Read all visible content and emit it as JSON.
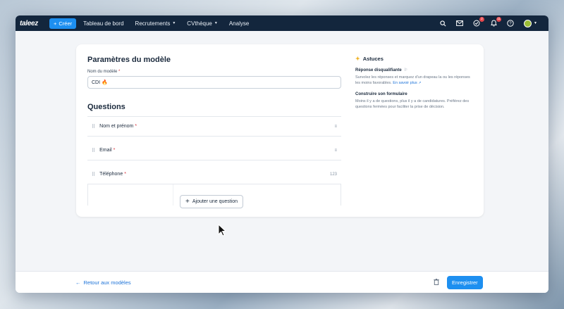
{
  "topbar": {
    "logo": "taleez",
    "create_label": "Créer",
    "nav": [
      {
        "label": "Tableau de bord",
        "has_caret": false
      },
      {
        "label": "Recrutements",
        "has_caret": true
      },
      {
        "label": "CVthèque",
        "has_caret": true
      },
      {
        "label": "Analyse",
        "has_caret": false
      }
    ],
    "badges": {
      "tasks": "2",
      "notifications": "11"
    }
  },
  "form": {
    "title": "Paramètres du modèle",
    "name_label": "Nom du modèle",
    "required_mark": "*",
    "name_value": "CDI",
    "name_emoji": "🔥",
    "questions_title": "Questions",
    "questions": [
      {
        "label": "Nom et prénom",
        "required": "*",
        "type_icon": "≡"
      },
      {
        "label": "Email",
        "required": "*",
        "type_icon": "≡"
      },
      {
        "label": "Téléphone",
        "required": "*",
        "type_icon": "123"
      }
    ],
    "add_question_label": "Ajouter une question"
  },
  "tips": {
    "title": "Astuces",
    "items": [
      {
        "title": "Réponse disqualifiante",
        "body": "Survolez les réponses et marquez d'un drapeau la ou les réponses les moins favorables.",
        "link": "En savoir plus"
      },
      {
        "title": "Construire son formulaire",
        "body": "Moins il y a de questions, plus il y a de candidatures. Préférez des questions fermées pour faciliter la prise de décision."
      }
    ]
  },
  "footer": {
    "back_label": "Retour aux modèles",
    "save_label": "Enregistrer"
  },
  "colors": {
    "nav_bg": "#13263d",
    "primary": "#1d8ff0",
    "link": "#1d73d8",
    "required": "#d8323a",
    "badge": "#e5484d"
  }
}
